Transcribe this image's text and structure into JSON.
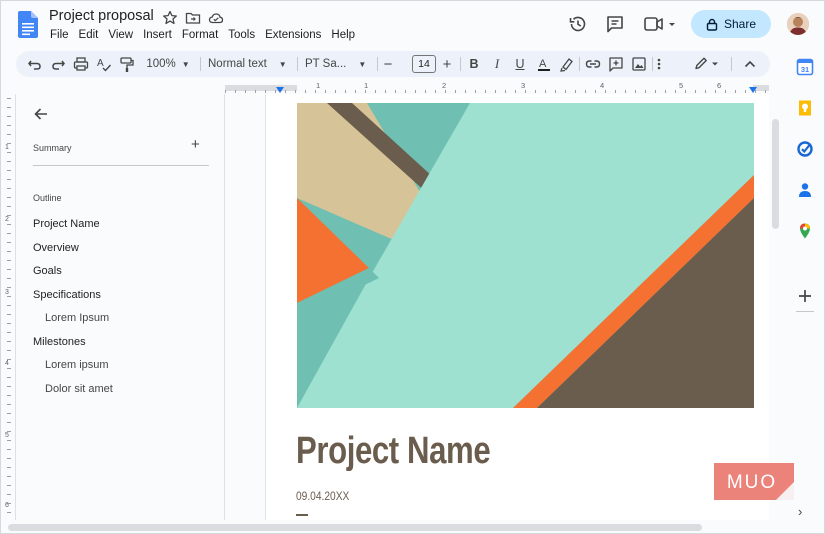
{
  "doc": {
    "title": "Project proposal",
    "menu": [
      "File",
      "Edit",
      "View",
      "Insert",
      "Format",
      "Tools",
      "Extensions",
      "Help"
    ],
    "share_label": "Share"
  },
  "toolbar": {
    "zoom": "100%",
    "style": "Normal text",
    "font": "PT Sa...",
    "font_size": "14"
  },
  "ruler": {
    "h_numbers": [
      "1",
      "1",
      "2",
      "3",
      "4",
      "5",
      "6"
    ],
    "v_numbers": [
      "1",
      "2",
      "3",
      "4",
      "5",
      "6"
    ]
  },
  "outline": {
    "summary_label": "Summary",
    "outline_label": "Outline",
    "items": [
      {
        "label": "Project Name",
        "level": 1
      },
      {
        "label": "Overview",
        "level": 1
      },
      {
        "label": "Goals",
        "level": 1
      },
      {
        "label": "Specifications",
        "level": 1
      },
      {
        "label": "Lorem Ipsum",
        "level": 2
      },
      {
        "label": "Milestones",
        "level": 1
      },
      {
        "label": "Lorem ipsum",
        "level": 2
      },
      {
        "label": "Dolor sit amet",
        "level": 2
      }
    ]
  },
  "document": {
    "heading": "Project Name",
    "date": "09.04.20XX"
  },
  "watermark": {
    "text": "MUO"
  },
  "colors": {
    "accent": "#1a73e8",
    "share_bg": "#c2e7ff",
    "heading": "#6b5d4d",
    "teal": "#9fe1d1",
    "teal_dark": "#6bbfb1",
    "tan": "#d4c095",
    "orange": "#f47131",
    "brown": "#6b5d4d"
  }
}
